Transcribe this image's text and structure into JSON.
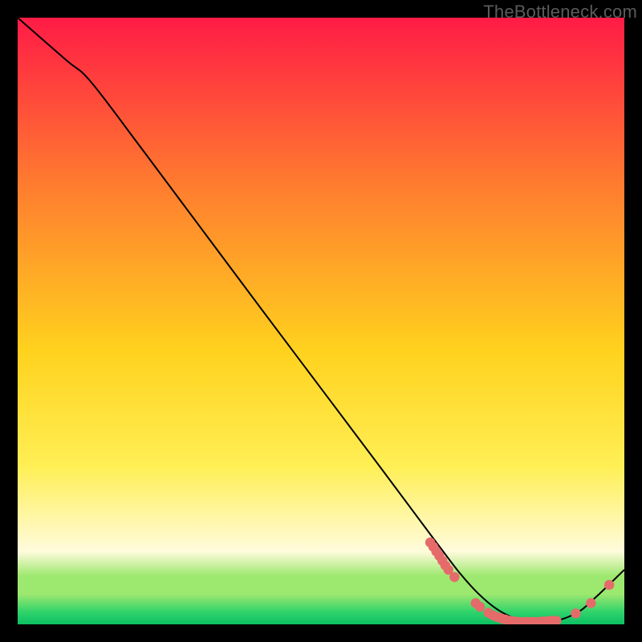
{
  "watermark": "TheBottleneck.com",
  "colors": {
    "bg": "#000000",
    "curve": "#000000",
    "dot_fill": "#e56b6b",
    "dot_stroke": "#c94f54",
    "grad_top": "#ff1b46",
    "grad_mid_upper": "#ff7a2f",
    "grad_mid": "#ffd21e",
    "grad_mid_lower": "#ffef55",
    "grad_pale": "#fffbdc",
    "grad_green1": "#9de86f",
    "grad_green2": "#2fd36b",
    "grad_green3": "#0cbf62",
    "watermark": "#5b5b5b"
  },
  "chart_data": {
    "type": "line",
    "title": "",
    "xlabel": "",
    "ylabel": "",
    "xlim": [
      0,
      100
    ],
    "ylim": [
      0,
      100
    ],
    "series": [
      {
        "name": "curve",
        "x": [
          0,
          8,
          12,
          20,
          30,
          40,
          50,
          60,
          67,
          70,
          73,
          76,
          79,
          82,
          85,
          88,
          92,
          95,
          100
        ],
        "y": [
          100,
          93,
          89.5,
          79,
          65.6,
          52.2,
          38.9,
          25.6,
          16.2,
          12.2,
          8.3,
          5.0,
          2.5,
          1.0,
          0.4,
          0.4,
          1.8,
          4.2,
          9.0
        ]
      }
    ],
    "dots": [
      {
        "x": 68.0,
        "y": 13.5
      },
      {
        "x": 68.5,
        "y": 12.8
      },
      {
        "x": 69.0,
        "y": 12.0
      },
      {
        "x": 69.5,
        "y": 11.3
      },
      {
        "x": 70.0,
        "y": 10.5
      },
      {
        "x": 70.5,
        "y": 9.7
      },
      {
        "x": 71.0,
        "y": 9.0
      },
      {
        "x": 72.0,
        "y": 7.8
      },
      {
        "x": 75.5,
        "y": 3.5
      },
      {
        "x": 76.2,
        "y": 2.9
      },
      {
        "x": 77.6,
        "y": 1.9
      },
      {
        "x": 78.3,
        "y": 1.5
      },
      {
        "x": 79.0,
        "y": 1.2
      },
      {
        "x": 79.7,
        "y": 1.0
      },
      {
        "x": 80.4,
        "y": 0.8
      },
      {
        "x": 81.1,
        "y": 0.6
      },
      {
        "x": 81.8,
        "y": 0.5
      },
      {
        "x": 82.5,
        "y": 0.4
      },
      {
        "x": 83.2,
        "y": 0.4
      },
      {
        "x": 83.9,
        "y": 0.4
      },
      {
        "x": 84.6,
        "y": 0.4
      },
      {
        "x": 85.3,
        "y": 0.4
      },
      {
        "x": 86.0,
        "y": 0.4
      },
      {
        "x": 86.7,
        "y": 0.5
      },
      {
        "x": 87.4,
        "y": 0.5
      },
      {
        "x": 88.1,
        "y": 0.6
      },
      {
        "x": 88.8,
        "y": 0.6
      },
      {
        "x": 92.0,
        "y": 1.8
      },
      {
        "x": 94.5,
        "y": 3.5
      },
      {
        "x": 97.5,
        "y": 6.5
      }
    ]
  }
}
